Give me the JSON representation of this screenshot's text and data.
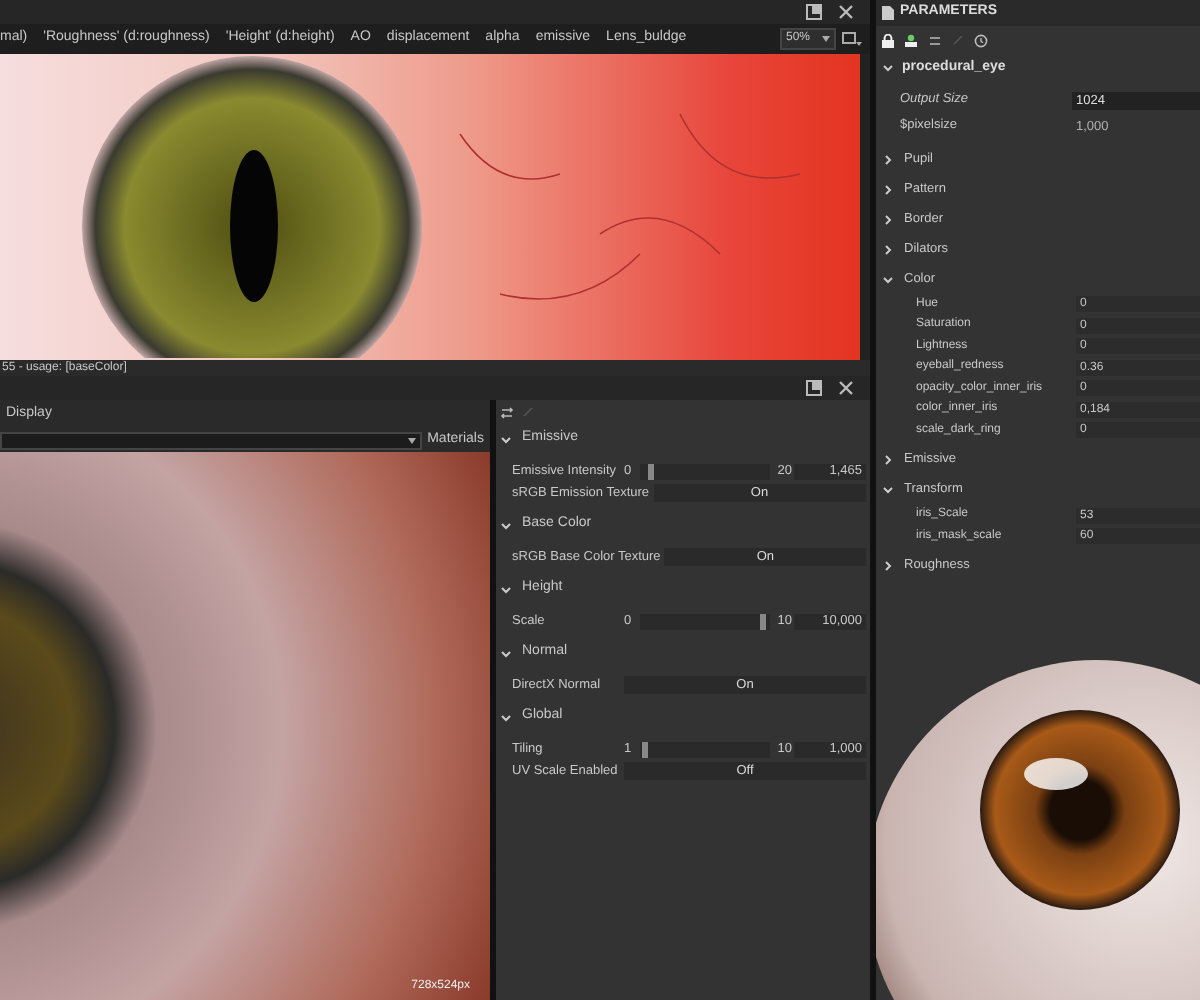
{
  "viewer_2d": {
    "tabs": [
      {
        "label": "mal)",
        "selected": false
      },
      {
        "label": "'Roughness' (d:roughness)",
        "selected": false
      },
      {
        "label": "'Height' (d:height)",
        "selected": false
      },
      {
        "label": "AO",
        "selected": false
      },
      {
        "label": "displacement",
        "selected": false
      },
      {
        "label": "alpha",
        "selected": false
      },
      {
        "label": "emissive",
        "selected": false
      },
      {
        "label": "Lens_buldge",
        "selected": false
      }
    ],
    "zoom": "50%",
    "status": "55 - usage: [baseColor]"
  },
  "viewer_3d": {
    "tab": "Display",
    "materials_label": "Materials",
    "resolution": "728x524px"
  },
  "properties": {
    "sections": [
      {
        "title": "Emissive",
        "expanded": true,
        "rows": [
          {
            "kind": "slider",
            "label": "Emissive Intensity",
            "min": "0",
            "max": "20",
            "value": "1,465",
            "level": 0.07
          },
          {
            "kind": "toggle",
            "label": "sRGB Emission Texture",
            "value": "On"
          }
        ]
      },
      {
        "title": "Base Color",
        "expanded": true,
        "rows": [
          {
            "kind": "toggle",
            "label": "sRGB Base Color Texture",
            "value": "On"
          }
        ]
      },
      {
        "title": "Height",
        "expanded": true,
        "rows": [
          {
            "kind": "slider",
            "label": "Scale",
            "min": "0",
            "max": "10",
            "value": "10,000",
            "level": 0.97
          }
        ]
      },
      {
        "title": "Normal",
        "expanded": true,
        "rows": [
          {
            "kind": "toggle",
            "label": "DirectX Normal",
            "value": "On"
          }
        ]
      },
      {
        "title": "Global",
        "expanded": true,
        "rows": [
          {
            "kind": "slider",
            "label": "Tiling",
            "min": "1",
            "max": "10",
            "value": "1,000",
            "level": 0.02
          },
          {
            "kind": "toggle",
            "label": "UV Scale Enabled",
            "value": "Off"
          }
        ]
      }
    ]
  },
  "parameters": {
    "title": "PARAMETERS",
    "graph": {
      "name": "procedural_eye",
      "expanded": true
    },
    "fields": [
      {
        "label": "Output Size",
        "value": "1024"
      },
      {
        "label": "$pixelsize",
        "value": "1,000"
      }
    ],
    "groups": [
      {
        "label": "Pupil",
        "expanded": false
      },
      {
        "label": "Pattern",
        "expanded": false
      },
      {
        "label": "Border",
        "expanded": false
      },
      {
        "label": "Dilators",
        "expanded": false
      },
      {
        "label": "Color",
        "expanded": true,
        "params": [
          {
            "label": "Hue",
            "value": "0"
          },
          {
            "label": "Saturation",
            "value": "0"
          },
          {
            "label": "Lightness",
            "value": "0"
          },
          {
            "label": "eyeball_redness",
            "value": "0.36"
          },
          {
            "label": "opacity_color_inner_iris",
            "value": "0"
          },
          {
            "label": "color_inner_iris",
            "value": "0,184"
          },
          {
            "label": "scale_dark_ring",
            "value": "0"
          }
        ]
      },
      {
        "label": "Emissive",
        "expanded": false
      },
      {
        "label": "Transform",
        "expanded": true,
        "params": [
          {
            "label": "iris_Scale",
            "value": "53"
          },
          {
            "label": "iris_mask_scale",
            "value": "60"
          }
        ]
      },
      {
        "label": "Roughness",
        "expanded": false
      }
    ]
  }
}
